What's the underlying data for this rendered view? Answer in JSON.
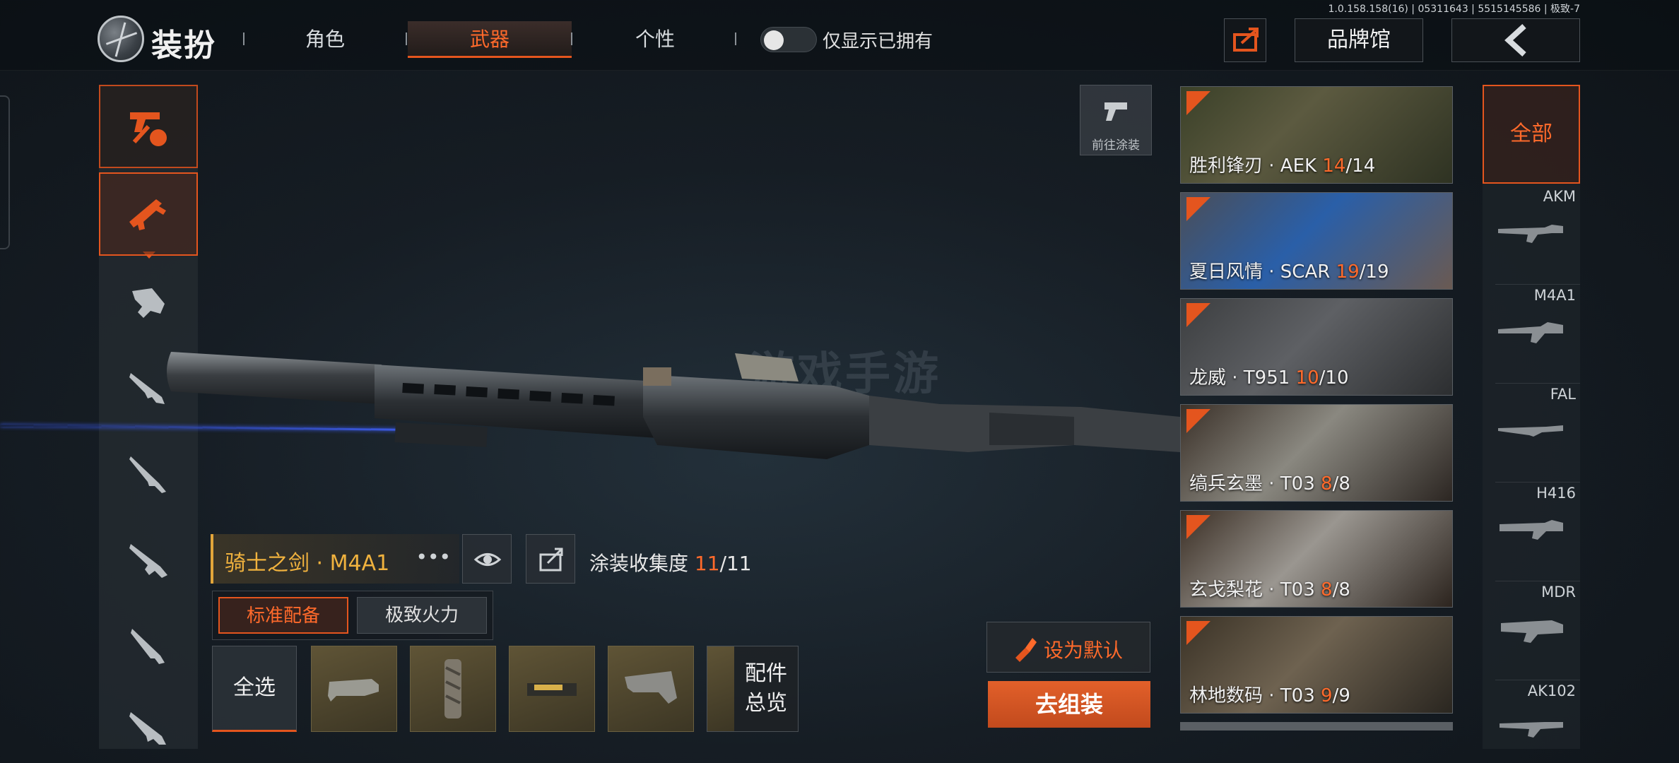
{
  "version": "1.0.158.158(16) | 05311643 | 5515145586 | 极致-7",
  "header": {
    "title": "装扮",
    "tabs": [
      {
        "label": "角色",
        "active": false
      },
      {
        "label": "武器",
        "active": true
      },
      {
        "label": "个性",
        "active": false
      }
    ],
    "toggle_label": "仅显示已拥有",
    "toggle_on": false,
    "brand_button": "品牌馆"
  },
  "watermark": "游戏手游",
  "goto_paint_label": "前往涂装",
  "skin": {
    "name": "骑士之剑 · M4A1",
    "collection_label": "涂装收集度",
    "collection_current": "11",
    "collection_total": "/11"
  },
  "modes": {
    "standard": "标准配备",
    "extreme": "极致火力"
  },
  "select_all": "全选",
  "attachments_overview": "配件总览",
  "actions": {
    "set_default": "设为默认",
    "go_assemble": "去组装"
  },
  "skin_list": [
    {
      "title": "胜利锋刃 · AEK ",
      "owned": "14",
      "total": "/14"
    },
    {
      "title": "夏日风情 · SCAR ",
      "owned": "19",
      "total": "/19"
    },
    {
      "title": "龙威 · T951 ",
      "owned": "10",
      "total": "/10"
    },
    {
      "title": "缟兵玄墨 · T03 ",
      "owned": "8",
      "total": "/8"
    },
    {
      "title": "玄戈梨花 · T03 ",
      "owned": "8",
      "total": "/8"
    },
    {
      "title": "林地数码 · T03 ",
      "owned": "9",
      "total": "/9"
    }
  ],
  "weapon_filter": {
    "all_label": "全部",
    "weapons": [
      "AKM",
      "M4A1",
      "FAL",
      "H416",
      "MDR",
      "AK102"
    ]
  },
  "colors": {
    "accent": "#e4551e",
    "accent_text": "#ff6a2b",
    "skin_name": "#f0b23e",
    "laser": "#3d5df0"
  }
}
